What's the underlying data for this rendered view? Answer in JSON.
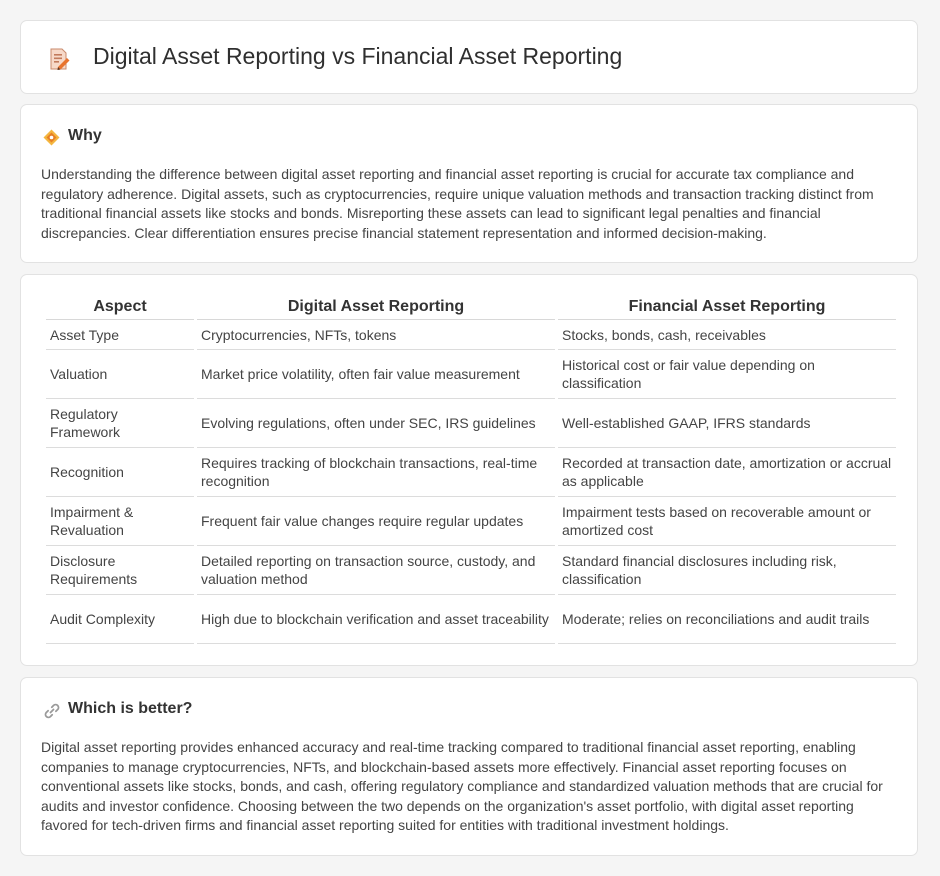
{
  "header": {
    "title": "Digital Asset Reporting vs Financial Asset Reporting",
    "icon": "document-pencil-icon"
  },
  "why": {
    "heading": "Why",
    "icon": "diamond-icon",
    "text": "Understanding the difference between digital asset reporting and financial asset reporting is crucial for accurate tax compliance and regulatory adherence. Digital assets, such as cryptocurrencies, require unique valuation methods and transaction tracking distinct from traditional financial assets like stocks and bonds. Misreporting these assets can lead to significant legal penalties and financial discrepancies. Clear differentiation ensures precise financial statement representation and informed decision-making."
  },
  "table": {
    "headers": [
      "Aspect",
      "Digital Asset Reporting",
      "Financial Asset Reporting"
    ],
    "rows": [
      [
        "Asset Type",
        "Cryptocurrencies, NFTs, tokens",
        "Stocks, bonds, cash, receivables"
      ],
      [
        "Valuation",
        "Market price volatility, often fair value measurement",
        "Historical cost or fair value depending on classification"
      ],
      [
        "Regulatory Framework",
        "Evolving regulations, often under SEC, IRS guidelines",
        "Well-established GAAP, IFRS standards"
      ],
      [
        "Recognition",
        "Requires tracking of blockchain transactions, real-time recognition",
        "Recorded at transaction date, amortization or accrual as applicable"
      ],
      [
        "Impairment & Revaluation",
        "Frequent fair value changes require regular updates",
        "Impairment tests based on recoverable amount or amortized cost"
      ],
      [
        "Disclosure Requirements",
        "Detailed reporting on transaction source, custody, and valuation method",
        "Standard financial disclosures including risk, classification"
      ],
      [
        "Audit Complexity",
        "High due to blockchain verification and asset traceability",
        "Moderate; relies on reconciliations and audit trails"
      ]
    ]
  },
  "better": {
    "heading": "Which is better?",
    "icon": "link-icon",
    "text": "Digital asset reporting provides enhanced accuracy and real-time tracking compared to traditional financial asset reporting, enabling companies to manage cryptocurrencies, NFTs, and blockchain-based assets more effectively. Financial asset reporting focuses on conventional assets like stocks, bonds, and cash, offering regulatory compliance and standardized valuation methods that are crucial for audits and investor confidence. Choosing between the two depends on the organization's asset portfolio, with digital asset reporting favored for tech-driven firms and financial asset reporting suited for entities with traditional investment holdings."
  }
}
